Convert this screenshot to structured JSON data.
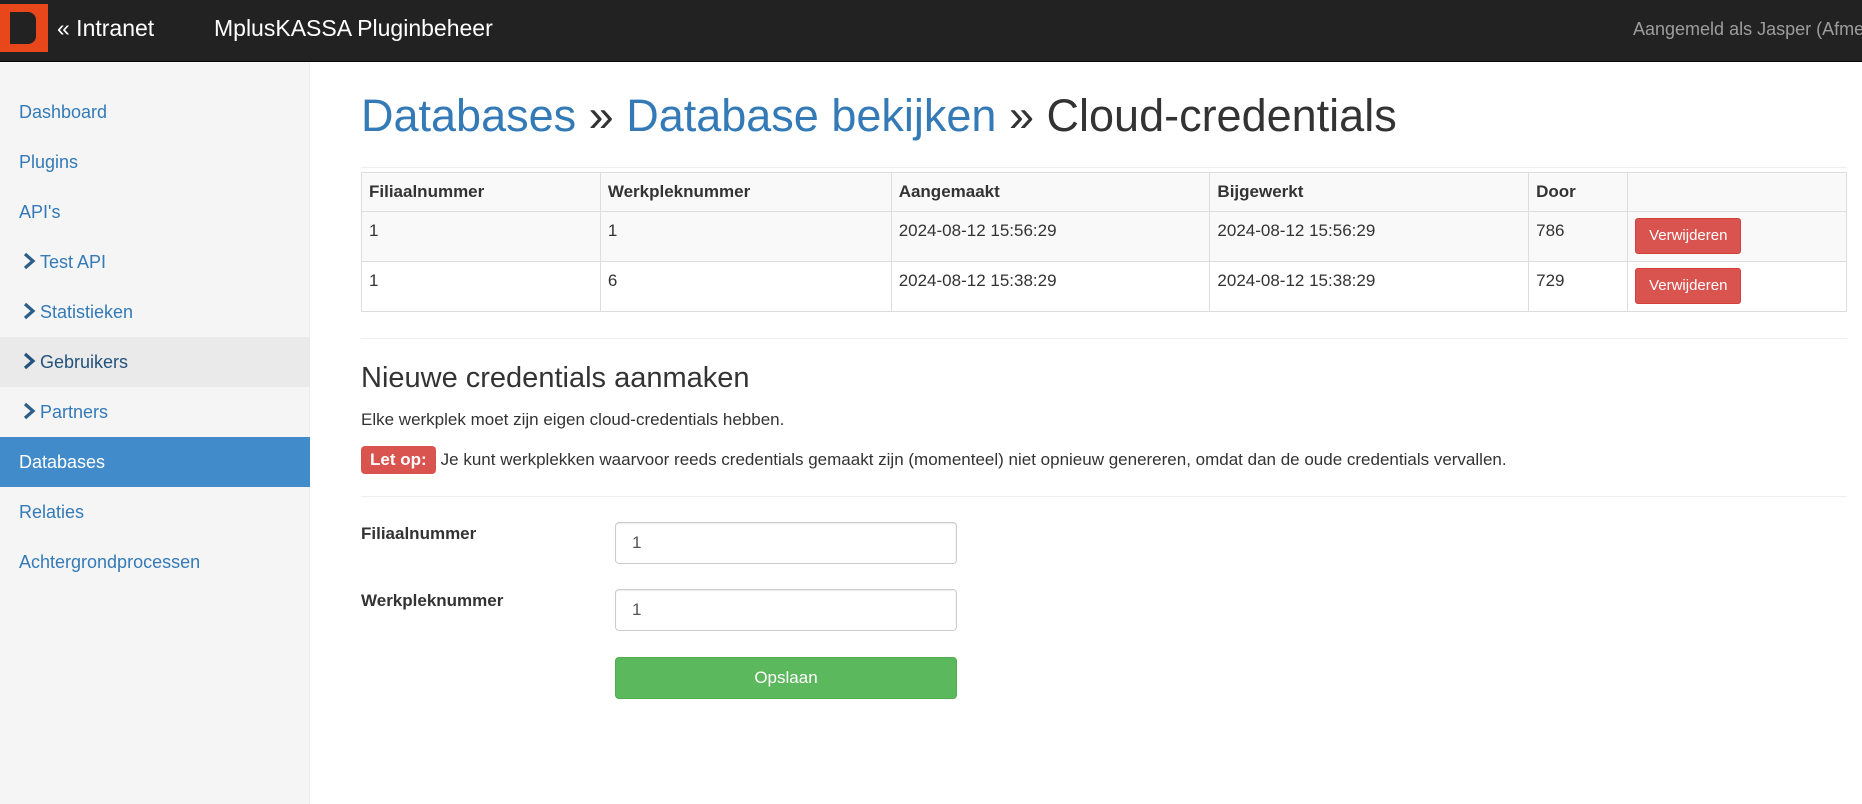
{
  "navbar": {
    "back_label": "« Intranet",
    "app_title": "MplusKASSA Pluginbeheer",
    "user_text": "Aangemeld als Jasper (Afmelden)",
    "logo_color": "#e8461b"
  },
  "sidebar": {
    "items": [
      {
        "label": "Dashboard"
      },
      {
        "label": "Plugins"
      },
      {
        "label": "API's"
      },
      {
        "label": "Test API",
        "icon": "chevron-right-icon"
      },
      {
        "label": "Statistieken",
        "icon": "chevron-right-icon"
      },
      {
        "label": "Gebruikers",
        "icon": "chevron-right-icon"
      },
      {
        "label": "Partners",
        "icon": "chevron-right-icon"
      },
      {
        "label": "Databases",
        "active": true
      },
      {
        "label": "Relaties"
      },
      {
        "label": "Achtergrondprocessen"
      }
    ]
  },
  "header": {
    "crumb1": "Databases",
    "sep": "»",
    "crumb2": "Database bekijken",
    "current": "Cloud-credentials"
  },
  "table": {
    "columns": [
      "Filiaalnummer",
      "Werkpleknummer",
      "Aangemaakt",
      "Bijgewerkt",
      "Door",
      ""
    ],
    "rows": [
      {
        "filiaal": "1",
        "werkplek": "1",
        "aangemaakt": "2024-08-12 15:56:29",
        "bijgewerkt": "2024-08-12 15:56:29",
        "door": "786",
        "action": "Verwijderen"
      },
      {
        "filiaal": "1",
        "werkplek": "6",
        "aangemaakt": "2024-08-12 15:38:29",
        "bijgewerkt": "2024-08-12 15:38:29",
        "door": "729",
        "action": "Verwijderen"
      }
    ]
  },
  "form": {
    "title": "Nieuwe credentials aanmaken",
    "help": "Elke werkplek moet zijn eigen cloud-credentials hebben.",
    "warning_label": "Let op:",
    "warning_text": "Je kunt werkplekken waarvoor reeds credentials gemaakt zijn (momenteel) niet opnieuw genereren, omdat dan de oude credentials vervallen.",
    "filiaal_label": "Filiaalnummer",
    "filiaal_value": "1",
    "werkplek_label": "Werkpleknummer",
    "werkplek_value": "1",
    "submit_label": "Opslaan"
  }
}
